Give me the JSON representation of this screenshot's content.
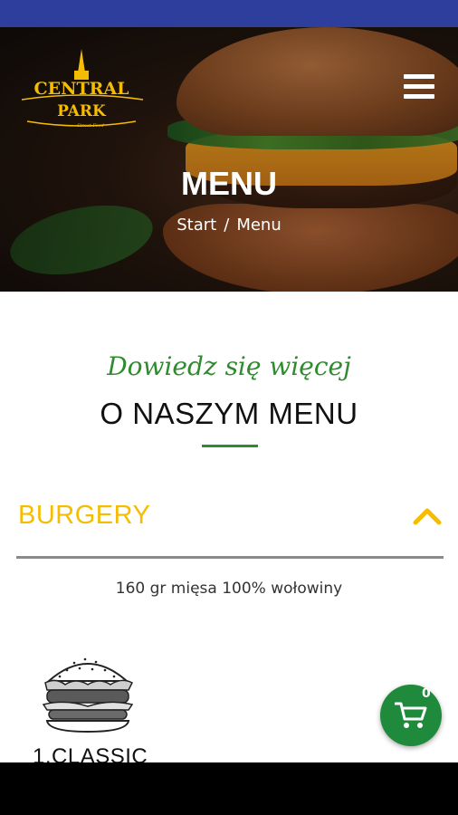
{
  "header": {
    "logo_text_top": "CENTRAL",
    "logo_text_bottom": "PARK",
    "logo_tagline": "Street Food",
    "menu_icon": "hamburger-menu-icon"
  },
  "hero": {
    "title": "MENU",
    "breadcrumb": {
      "start": "Start",
      "separator": "/",
      "current": "Menu"
    }
  },
  "intro": {
    "subtitle": "Dowiedz się więcej",
    "title": "O NASZYM MENU"
  },
  "category": {
    "name": "BURGERY",
    "toggle_icon": "chevron-up-icon",
    "description": "160 gr mięsa 100% wołowiny"
  },
  "products": [
    {
      "name": "1.CLASSIC",
      "image": "burger-sketch"
    }
  ],
  "cart": {
    "icon": "shopping-cart-icon",
    "count": "0"
  },
  "colors": {
    "statusbar": "#2e3e9c",
    "accent_yellow": "#f5bd02",
    "accent_green": "#2e8b2e",
    "cart_green": "#1f8a3c"
  }
}
